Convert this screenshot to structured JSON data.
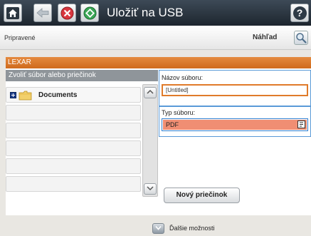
{
  "header": {
    "title": "Uložiť na USB",
    "home_icon": "home-icon",
    "back_icon": "back-arrow-icon",
    "stop_icon": "stop-icon",
    "start_icon": "start-icon",
    "help_icon": "help-icon",
    "help_glyph": "?"
  },
  "status": {
    "text": "Pripravené",
    "preview_label": "Náhľad",
    "preview_icon": "magnifier-icon"
  },
  "location": {
    "device_name": "LEXAR"
  },
  "file_browser": {
    "header": "Zvoliť súbor alebo priečinok",
    "items": [
      {
        "label": "Documents",
        "type": "folder",
        "expand_icon": "plus-icon",
        "icon": "folder-icon"
      },
      {
        "label": ""
      },
      {
        "label": ""
      },
      {
        "label": ""
      },
      {
        "label": ""
      },
      {
        "label": ""
      }
    ],
    "scroll_up_icon": "chevron-up-icon",
    "scroll_down_icon": "chevron-down-icon"
  },
  "file_name": {
    "label": "Názov súboru:",
    "value": "[Untitled]"
  },
  "file_type": {
    "label": "Typ súboru:",
    "value": "PDF",
    "icon": "document-icon"
  },
  "new_folder_button": "Nový priečinok",
  "more_options": {
    "label": "Ďalšie možnosti",
    "icon": "chevron-down-icon"
  },
  "colors": {
    "accent_orange": "#d6732a",
    "stop_red": "#d9363e",
    "start_green": "#3aa655",
    "type_fill": "#f08e73",
    "focus_blue": "#2f7fd0"
  }
}
